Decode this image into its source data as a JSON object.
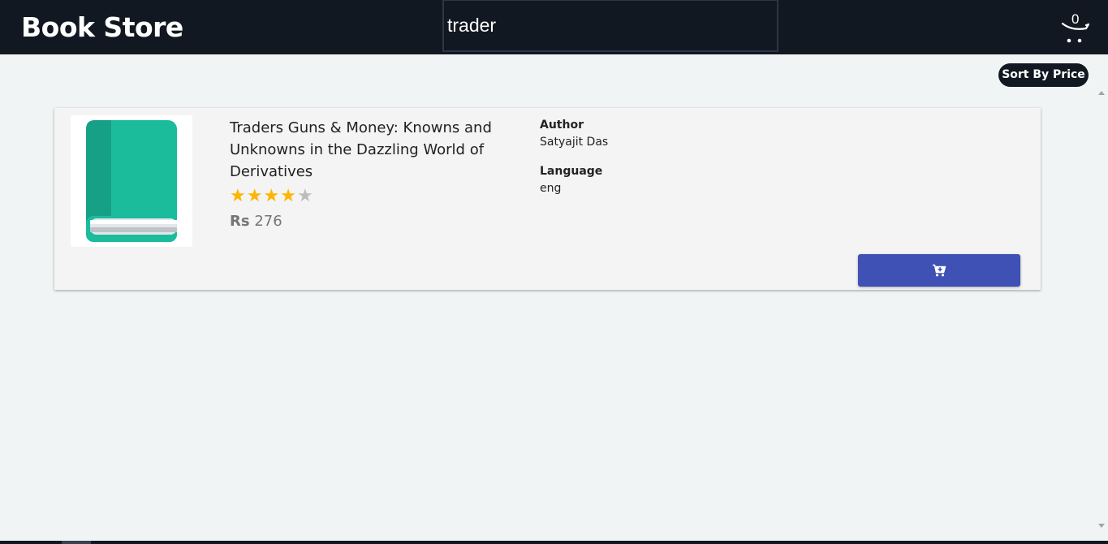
{
  "header": {
    "brand": "Book Store",
    "search_value": "trader",
    "cart_count": "0"
  },
  "toolbar": {
    "sort_label": "Sort By Price"
  },
  "results": [
    {
      "title": "Traders Guns & Money: Knowns and Unknowns in the Dazzling World of Derivatives",
      "rating": 4,
      "rating_max": 5,
      "price_currency": "Rs",
      "price_value": "276",
      "author_label": "Author",
      "author": "Satyajit Das",
      "language_label": "Language",
      "language": "eng",
      "cover_icon": "book-icon",
      "add_icon": "add-to-cart-icon"
    }
  ],
  "colors": {
    "header_bg": "#111821",
    "page_bg": "#f0f4f4",
    "card_bg": "#f4f4f4",
    "button_bg": "#3f51b5",
    "star_on": "#ffb400",
    "star_off": "#bdbdbd",
    "book_cover": "#1abc9c"
  }
}
